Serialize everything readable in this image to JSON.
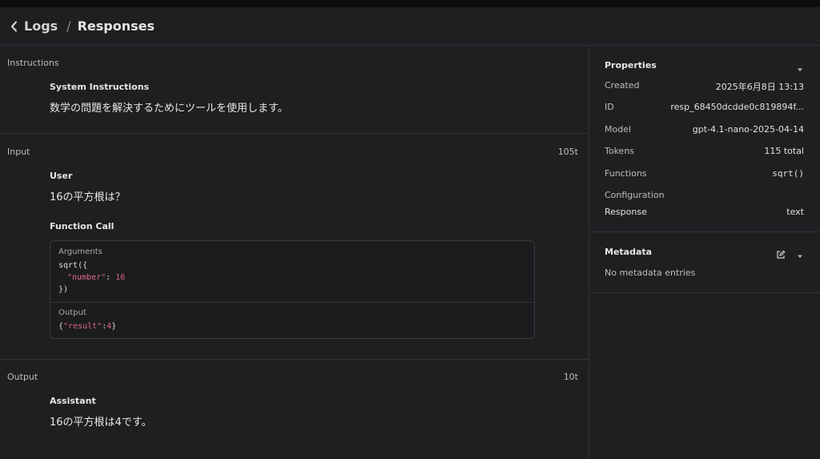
{
  "breadcrumb": {
    "parent": "Logs",
    "separator": "/",
    "current": "Responses"
  },
  "instructions": {
    "label": "Instructions",
    "role": "System Instructions",
    "text": "数学の問題を解決するためにツールを使用します。"
  },
  "input": {
    "label": "Input",
    "tokens": "105t",
    "user_role": "User",
    "user_text": "16の平方根は？",
    "function_call_title": "Function Call",
    "arguments_label": "Arguments",
    "args_line1": "sqrt({",
    "args_key": "\"number\"",
    "args_colon": ": ",
    "args_value": "16",
    "args_line3": "})",
    "output_label": "Output",
    "output_open": "{",
    "output_key": "\"result\"",
    "output_colon": ":",
    "output_value": "4",
    "output_close": "}"
  },
  "output": {
    "label": "Output",
    "tokens": "10t",
    "role": "Assistant",
    "text": "16の平方根は4です。"
  },
  "properties": {
    "title": "Properties",
    "created_label": "Created",
    "created_value": "2025年6月8日 13:13",
    "id_label": "ID",
    "id_value": "resp_68450dcdde0c819894f...",
    "model_label": "Model",
    "model_value": "gpt-4.1-nano-2025-04-14",
    "tokens_label": "Tokens",
    "tokens_value": "115 total",
    "functions_label": "Functions",
    "functions_value": "sqrt()",
    "configuration_label": "Configuration",
    "response_label": "Response",
    "response_value": "text"
  },
  "metadata": {
    "title": "Metadata",
    "empty_text": "No metadata entries"
  },
  "icons": [
    "chevron-left-icon",
    "chevron-down-icon",
    "edit-icon"
  ]
}
